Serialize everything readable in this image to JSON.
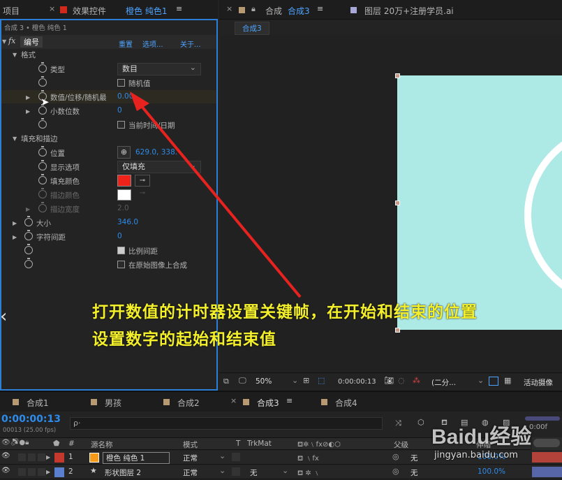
{
  "left_panel": {
    "tab_project": "项目",
    "tab_effects": "效果控件",
    "tab_effects_layer": "橙色 纯色1",
    "breadcrumb": "合成 3 • 橙色 纯色 1",
    "effect_name": "编号",
    "effect_links": [
      "重置",
      "选项...",
      "关于..."
    ],
    "props": [
      {
        "label": "格式"
      },
      {
        "label": "类型",
        "value": "数目"
      },
      {
        "label": "随机值"
      },
      {
        "label": "数值/位移/随机最",
        "value": "0.00"
      },
      {
        "label": "小数位数",
        "value": "0"
      },
      {
        "label": "当前时间/日期"
      },
      {
        "label": "填充和描边"
      },
      {
        "label": "位置",
        "value": "629.0, 338."
      },
      {
        "label": "显示选项",
        "value": "仅填充"
      },
      {
        "label": "填充颜色"
      },
      {
        "label": "描边颜色"
      },
      {
        "label": "描边宽度",
        "value": "2.0"
      },
      {
        "label": "大小",
        "value": "346.0"
      },
      {
        "label": "字符间距",
        "value": "0"
      },
      {
        "label": "比例间距"
      },
      {
        "label": "在原始图像上合成"
      }
    ]
  },
  "viewer": {
    "tab_comp": "合成",
    "tab_comp_name": "合成3",
    "tab_layer": "图层 20万+注册学员.ai",
    "comp_chip": "合成3",
    "zoom": "50%",
    "timecode": "0:00:00:13",
    "resolution": "(二分...",
    "active_camera": "活动摄像"
  },
  "caption": {
    "line1": "打开数值的计时器设置关键帧，在开始和结束的位置",
    "line2": "设置数字的起始和结束值"
  },
  "timeline": {
    "tabs": [
      "合成1",
      "男孩",
      "合成2",
      "合成3",
      "合成4"
    ],
    "timecode": "0:00:00:13",
    "frame_info": "00013 (25.00 fps)",
    "search_placeholder": "ρ‧",
    "headers": {
      "num": "#",
      "source": "源名称",
      "mode": "模式",
      "t": "T",
      "trkmat": "TrkMat",
      "parent": "父级",
      "stretch": "伸缩"
    },
    "ruler_label": "0:00f",
    "layers": [
      {
        "num": "1",
        "name": "橙色 纯色 1",
        "mode": "正常",
        "trkmat": "",
        "parent": "无",
        "stretch": "100.0%",
        "color": "#e8671e"
      },
      {
        "num": "2",
        "name": "形状图层 2",
        "mode": "正常",
        "trkmat": "无",
        "parent": "无",
        "stretch": "100.0%",
        "color": "#5b7fcf"
      }
    ]
  },
  "watermark": {
    "brand": "Baidu经验",
    "url": "jingyan.baidu.com"
  },
  "colors": {
    "fill": "#f0231b",
    "stroke": "#ffffff",
    "comp_bg": "#ade9e5",
    "accent": "#2d8ceb",
    "caption": "#f3f02b"
  }
}
